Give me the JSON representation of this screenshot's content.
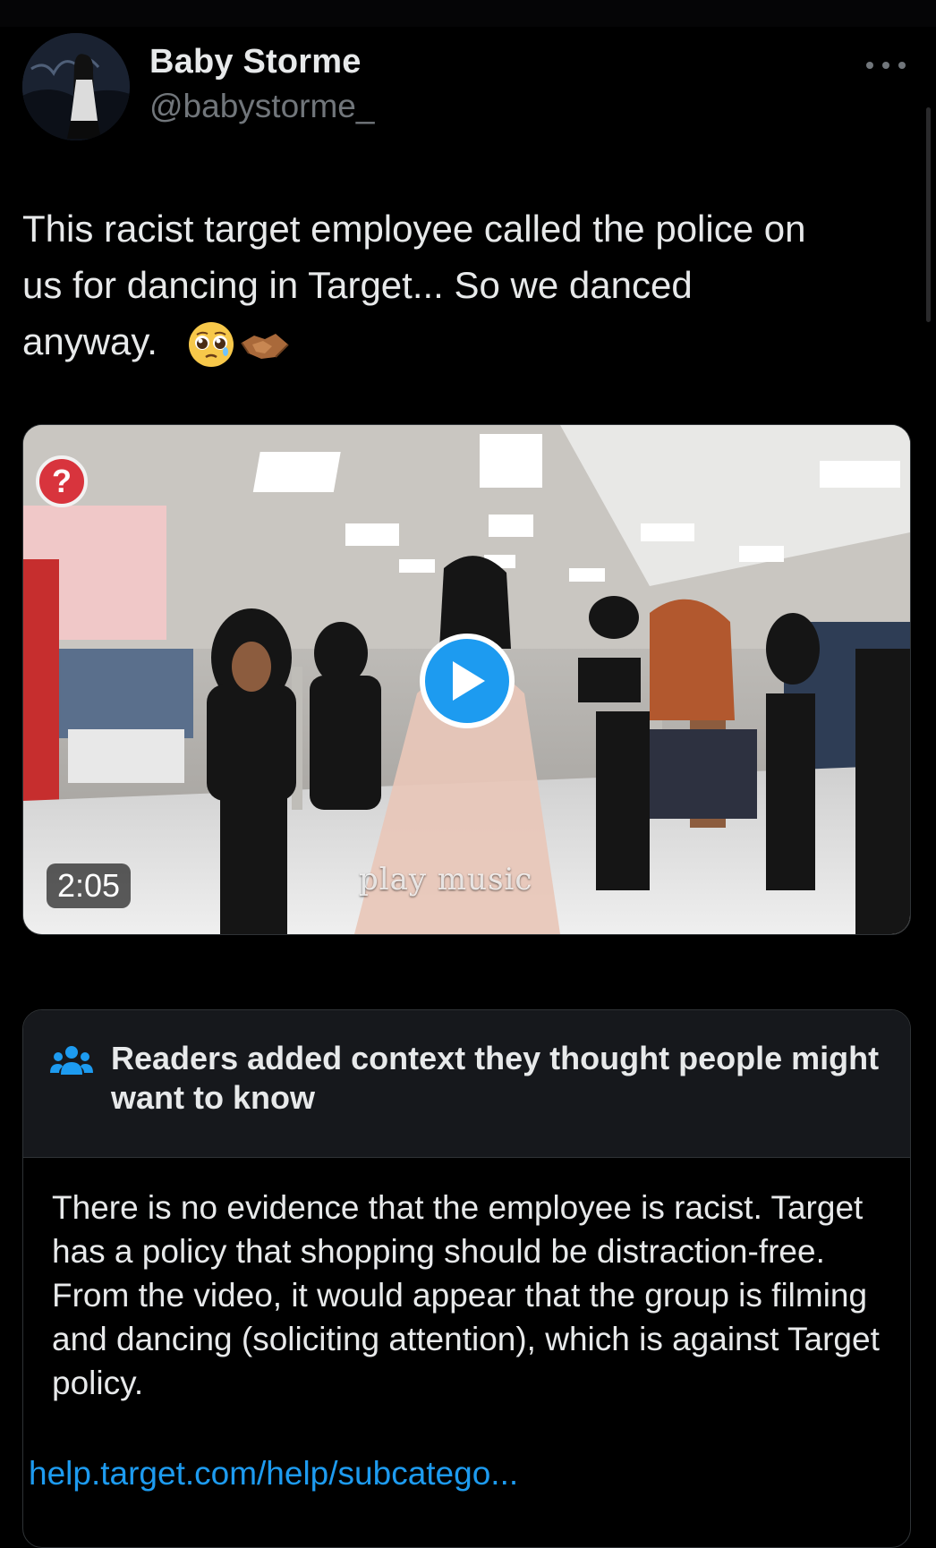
{
  "tweet": {
    "display_name": "Baby Storme",
    "handle": "@babystorme_",
    "text": "This racist target employee called the police on\nus for dancing in Target... So we danced\nanyway.",
    "emojis": [
      "pleading-face-emoji",
      "handshake-emoji"
    ],
    "more_icon": "more-horizontal-icon"
  },
  "media": {
    "type": "video",
    "duration": "2:05",
    "caption_overlay": "play music",
    "help_badge": "?",
    "play_icon": "play-icon"
  },
  "community_note": {
    "title": "Readers added context they thought people might want to know",
    "icon": "people-icon",
    "body": "There is no evidence that the employee is racist. Target has a policy that shopping should be distraction-free. From the video, it would appear that the group is filming and dancing (soliciting attention), which is against Target policy.",
    "link": "help.target.com/help/subcatego..."
  },
  "colors": {
    "background": "#000000",
    "text_primary": "#e7e9ea",
    "text_secondary": "#71767b",
    "accent": "#1d9bf0",
    "note_header_bg": "#16181c"
  }
}
